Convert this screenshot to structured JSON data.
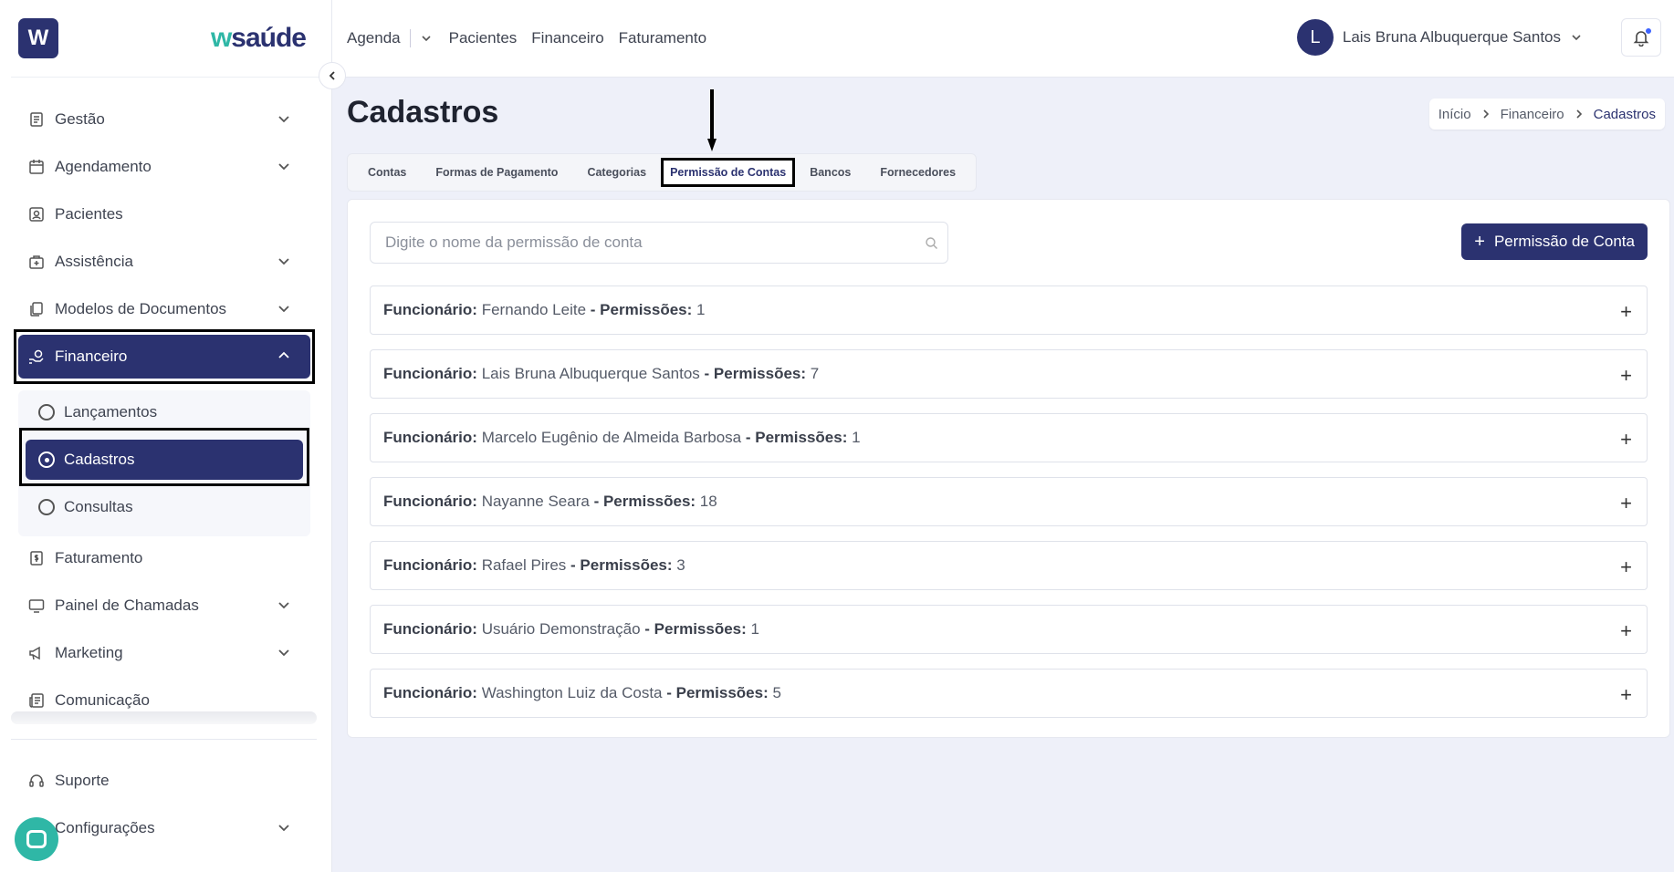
{
  "sidebar": {
    "logo_letter": "W",
    "brand_w": "w",
    "brand_rest": "saúde",
    "items": [
      {
        "label": "Gestão"
      },
      {
        "label": "Agendamento"
      },
      {
        "label": "Pacientes"
      },
      {
        "label": "Assistência"
      },
      {
        "label": "Modelos de Documentos"
      },
      {
        "label": "Financeiro"
      },
      {
        "label": "Faturamento"
      },
      {
        "label": "Painel de Chamadas"
      },
      {
        "label": "Marketing"
      },
      {
        "label": "Comunicação"
      },
      {
        "label": "Suporte"
      },
      {
        "label": "Configurações"
      }
    ],
    "submenu": [
      {
        "label": "Lançamentos"
      },
      {
        "label": "Cadastros"
      },
      {
        "label": "Consultas"
      }
    ]
  },
  "topbar": {
    "nav": [
      "Agenda",
      "Pacientes",
      "Financeiro",
      "Faturamento"
    ],
    "user_initial": "L",
    "user_name": "Lais Bruna Albuquerque Santos"
  },
  "page": {
    "title": "Cadastros",
    "breadcrumb": [
      "Início",
      "Financeiro",
      "Cadastros"
    ],
    "tabs": [
      "Contas",
      "Formas de Pagamento",
      "Categorias",
      "Permissão de Contas",
      "Bancos",
      "Fornecedores"
    ],
    "active_tab": "Permissão de Contas",
    "search_placeholder": "Digite o nome da permissão de conta",
    "add_button": "Permissão de Conta",
    "employee_label": "Funcionário:",
    "permissions_label": "- Permissões:",
    "rows": [
      {
        "name": "Fernando Leite",
        "count": "1"
      },
      {
        "name": "Lais Bruna Albuquerque Santos",
        "count": "7"
      },
      {
        "name": "Marcelo Eugênio de Almeida Barbosa",
        "count": "1"
      },
      {
        "name": "Nayanne Seara",
        "count": "18"
      },
      {
        "name": "Rafael Pires",
        "count": "3"
      },
      {
        "name": "Usuário Demonstração",
        "count": "1"
      },
      {
        "name": "Washington Luiz da Costa",
        "count": "5"
      }
    ]
  },
  "colors": {
    "primary": "#2b3270",
    "accent": "#2fb7a6",
    "background": "#eef0f9"
  }
}
